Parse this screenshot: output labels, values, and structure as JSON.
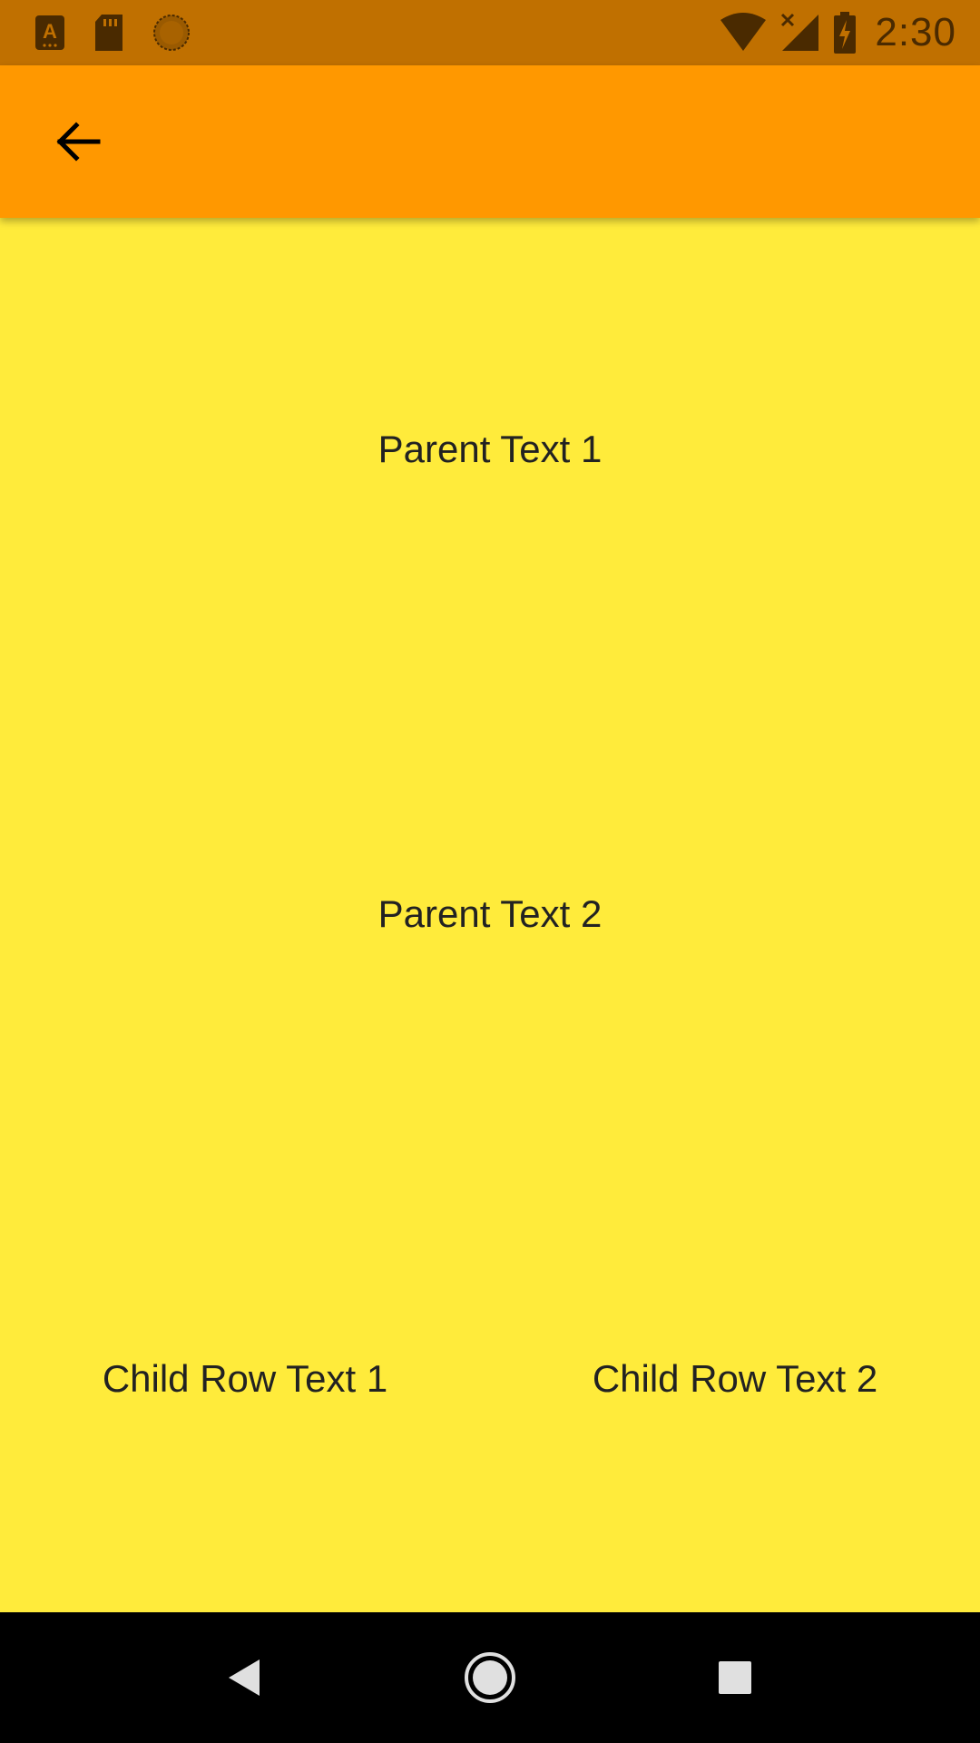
{
  "status_bar": {
    "time": "2:30",
    "left_icons": [
      "font-notification-icon",
      "sd-card-icon",
      "sync-circle-icon"
    ],
    "right_icons": [
      "wifi-icon",
      "cell-signal-off-icon",
      "battery-charging-icon"
    ],
    "background": "#c07000"
  },
  "app_bar": {
    "background": "#ff9800",
    "back_icon": "arrow-back-icon"
  },
  "content": {
    "background": "#ffeb3b",
    "parent_text_1": "Parent Text 1",
    "parent_text_2": "Parent Text 2",
    "child_row": {
      "text_1": "Child Row Text 1",
      "text_2": "Child Row Text 2"
    }
  },
  "nav_bar": {
    "buttons": [
      "back-triangle-icon",
      "home-circle-icon",
      "recents-square-icon"
    ]
  }
}
